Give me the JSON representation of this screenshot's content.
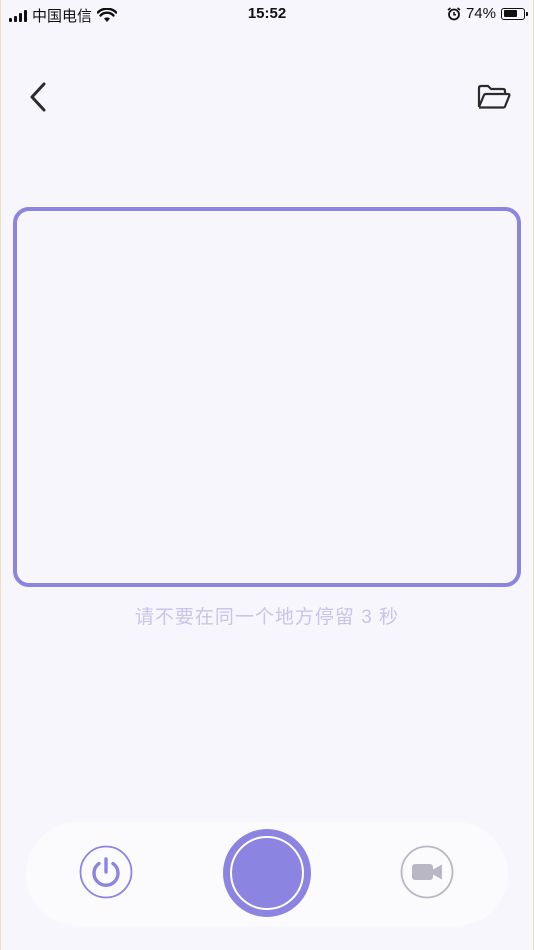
{
  "status_bar": {
    "carrier": "中国电信",
    "time": "15:52",
    "battery_percent": "74%",
    "battery_level": 0.74,
    "icons": [
      "signal-icon",
      "wifi-icon",
      "alarm-icon",
      "battery-icon"
    ]
  },
  "nav": {
    "back_icon": "chevron-left-icon",
    "folder_icon": "folder-open-icon"
  },
  "hint_text": "请不要在同一个地方停留 3 秒",
  "controls": {
    "power_icon": "power-icon",
    "record_button": "record-button",
    "video_icon": "video-camera-icon"
  },
  "colors": {
    "accent": "#8b84e0",
    "hint": "#c9c4ea",
    "background": "#f7f6fc",
    "inactive_icon": "#b9b7c4"
  }
}
